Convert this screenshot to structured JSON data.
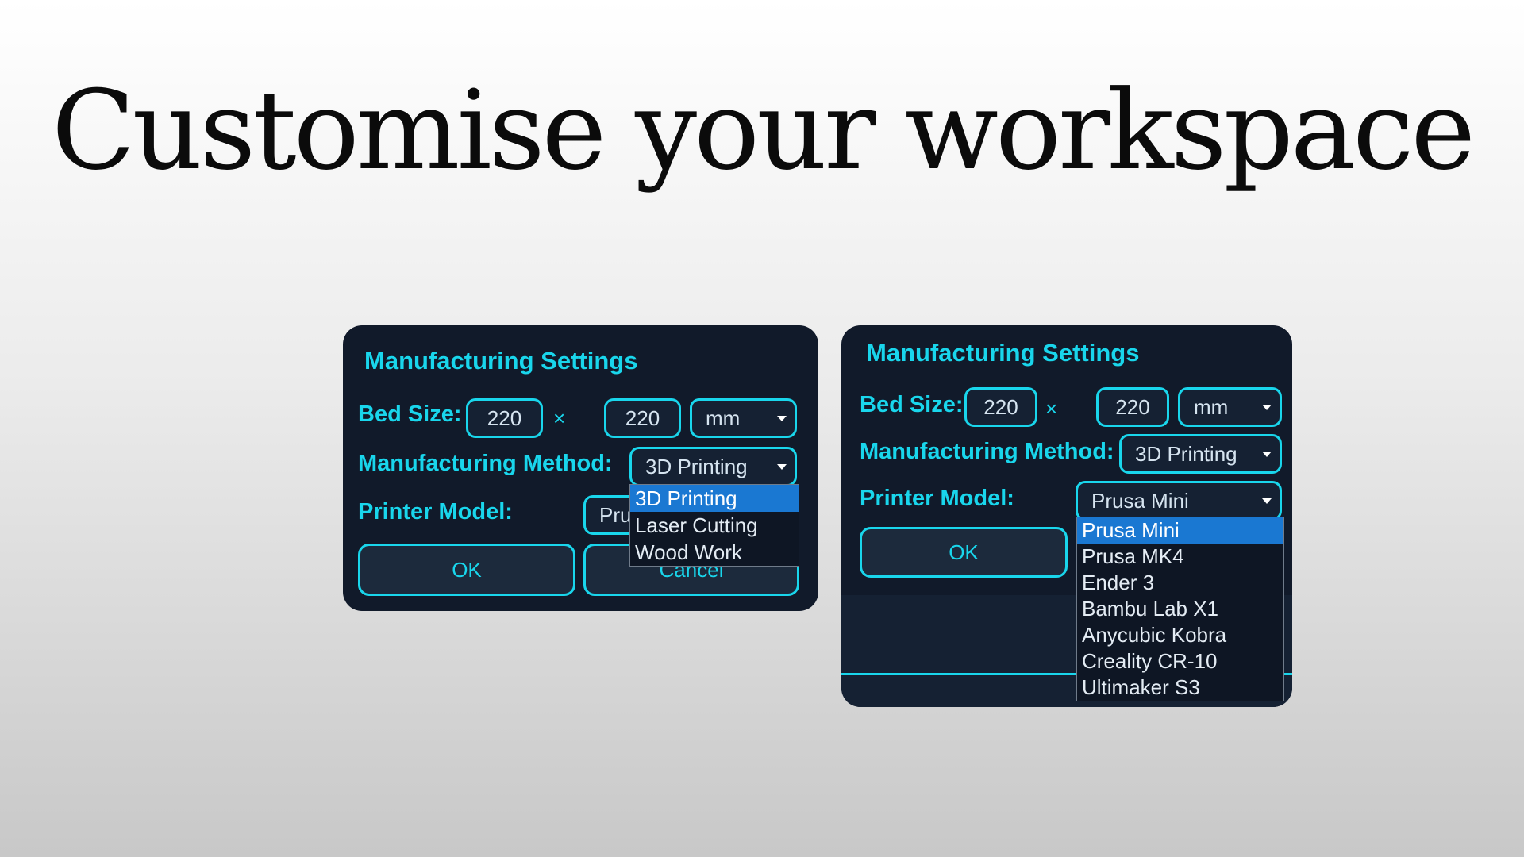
{
  "headline": "Customise your workspace",
  "colors": {
    "accent": "#19d6ec",
    "panel": "#111a2a",
    "highlight": "#1a78d2"
  },
  "dialog_left": {
    "title": "Manufacturing Settings",
    "bed_size_label": "Bed Size:",
    "bed_width": "220",
    "times": "×",
    "bed_depth": "220",
    "unit": "mm",
    "method_label": "Manufacturing Method:",
    "method_value": "3D Printing",
    "printer_label": "Printer Model:",
    "printer_value_partial": "Pru",
    "ok": "OK",
    "cancel": "Cancel",
    "method_options": [
      "3D Printing",
      "Laser Cutting",
      "Wood Work"
    ]
  },
  "dialog_right": {
    "title": "Manufacturing Settings",
    "bed_size_label": "Bed Size:",
    "bed_width": "220",
    "times": "×",
    "bed_depth": "220",
    "unit": "mm",
    "method_label": "Manufacturing Method:",
    "method_value": "3D Printing",
    "printer_label": "Printer Model:",
    "printer_value": "Prusa Mini",
    "ok": "OK",
    "printer_options": [
      "Prusa Mini",
      "Prusa MK4",
      "Ender 3",
      "Bambu Lab X1",
      "Anycubic Kobra",
      "Creality CR-10",
      "Ultimaker S3"
    ]
  }
}
